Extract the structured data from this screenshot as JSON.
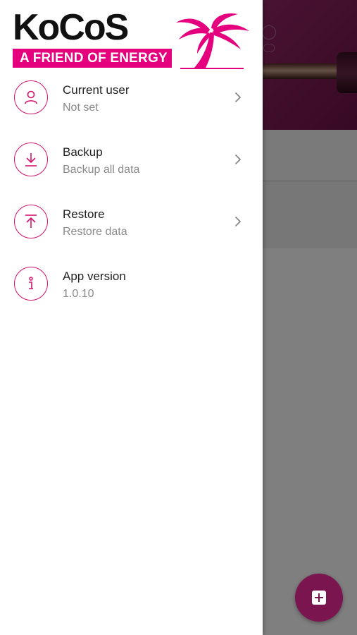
{
  "brand": {
    "logo_word": "KoCoS",
    "tagline": "A FRIEND OF ENERGY",
    "accent_color": "#e5007d",
    "primary_color": "#7a1550"
  },
  "drawer": {
    "items": [
      {
        "title": "Current user",
        "subtitle": "Not set",
        "icon": "user-icon",
        "has_chevron": true
      },
      {
        "title": "Backup",
        "subtitle": "Backup all data",
        "icon": "download-icon",
        "has_chevron": true
      },
      {
        "title": "Restore",
        "subtitle": "Restore data",
        "icon": "upload-icon",
        "has_chevron": true
      },
      {
        "title": "App version",
        "subtitle": "1.0.10",
        "icon": "info-icon",
        "has_chevron": false
      }
    ]
  },
  "fab": {
    "icon": "add-square-icon"
  }
}
